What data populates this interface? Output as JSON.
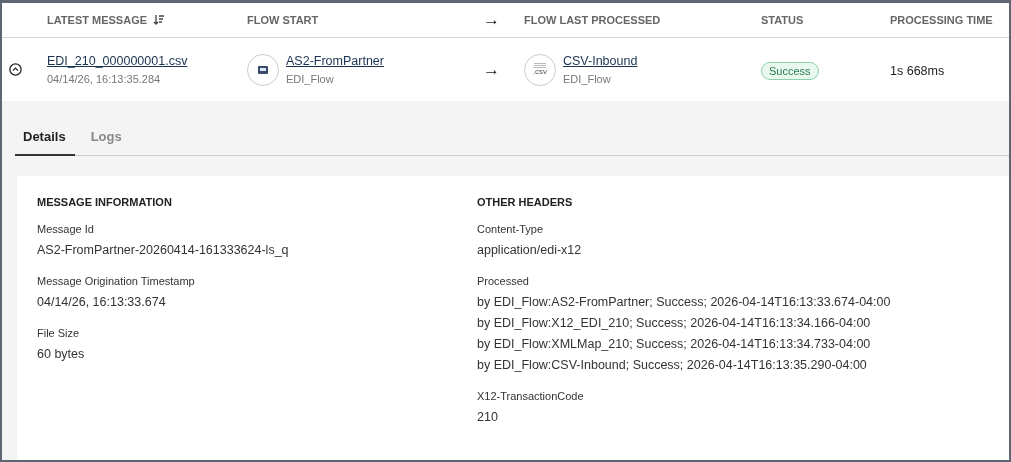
{
  "table": {
    "columns": [
      {
        "label": "LATEST MESSAGE",
        "sortable": true
      },
      {
        "label": "FLOW START",
        "sortable": false
      },
      {
        "label": "→",
        "sortable": false
      },
      {
        "label": "FLOW LAST PROCESSED",
        "sortable": false
      },
      {
        "label": "STATUS",
        "sortable": false
      },
      {
        "label": "PROCESSING TIME",
        "sortable": false
      }
    ],
    "rows": [
      {
        "expanded": true,
        "file": "EDI_210_000000001.csv",
        "time": "04/14/26, 16:13:35.284",
        "flow_start": {
          "name": "AS2-FromPartner",
          "group": "EDI_Flow",
          "kind": "as2"
        },
        "arrow": "→",
        "flow_last": {
          "name": "CSV-Inbound",
          "group": "EDI_Flow",
          "kind": "csv",
          "icon_text": ".csv"
        },
        "status": "Success",
        "processing_time": "1s 668ms"
      }
    ]
  },
  "tabs": [
    {
      "label": "Details",
      "selected": true
    },
    {
      "label": "Logs",
      "selected": false
    }
  ],
  "sections": [
    {
      "title": "MESSAGE INFORMATION",
      "fields": [
        {
          "label": "Message Id",
          "values": [
            "AS2-FromPartner-20260414-161333624-ls_q"
          ]
        },
        {
          "label": "Message Origination Timestamp",
          "values": [
            "04/14/26, 16:13:33.674"
          ]
        },
        {
          "label": "File Size",
          "values": [
            "60 bytes"
          ]
        }
      ]
    },
    {
      "title": "OTHER HEADERS",
      "fields": [
        {
          "label": "Content-Type",
          "values": [
            "application/edi-x12"
          ]
        },
        {
          "label": "Processed",
          "values": [
            "by EDI_Flow:AS2-FromPartner; Success; 2026-04-14T16:13:33.674-04:00",
            "by EDI_Flow:X12_EDI_210; Success; 2026-04-14T16:13:34.166-04:00",
            "by EDI_Flow:XMLMap_210; Success; 2026-04-14T16:13:34.733-04:00",
            "by EDI_Flow:CSV-Inbound; Success; 2026-04-14T16:13:35.290-04:00"
          ]
        },
        {
          "label": "X12-TransactionCode",
          "values": [
            "210"
          ]
        }
      ]
    }
  ]
}
